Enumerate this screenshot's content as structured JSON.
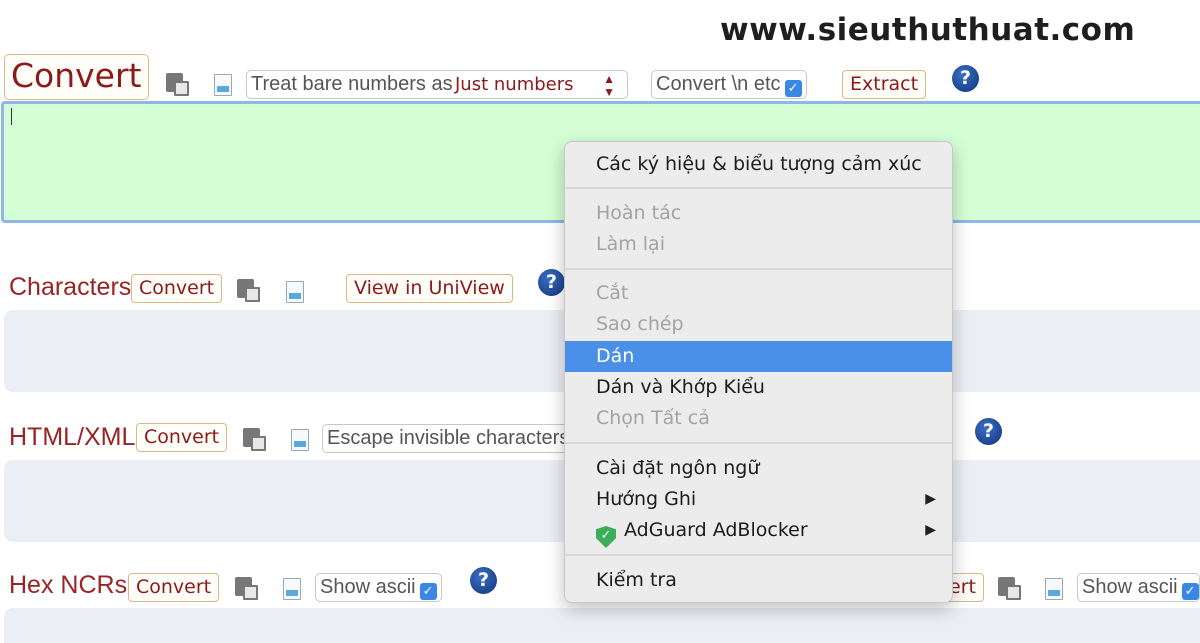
{
  "watermark": "www.sieuthuthuat.com",
  "top": {
    "convert_label": "Convert",
    "treat_label": "Treat bare numbers as",
    "treat_value": "Just numbers",
    "convert_n_label": "Convert \\n etc",
    "extract_label": "Extract",
    "help": "?"
  },
  "characters": {
    "label": "Characters",
    "convert_label": "Convert",
    "view_label": "View in UniView",
    "help": "?"
  },
  "html_xml": {
    "label": "HTML/XML",
    "convert_label": "Convert",
    "escape_label": "Escape invisible characters",
    "help": "?"
  },
  "hex": {
    "label": "Hex NCRs",
    "convert_label": "Convert",
    "show_ascii_label": "Show ascii",
    "help": "?",
    "right_convert_partial": "ert",
    "right_show_ascii": "Show ascii"
  },
  "context_menu": {
    "emoji": "Các ký hiệu & biểu tượng cảm xúc",
    "undo": "Hoàn tác",
    "redo": "Làm lại",
    "cut": "Cắt",
    "copy": "Sao chép",
    "paste": "Dán",
    "paste_match": "Dán và Khớp Kiểu",
    "select_all": "Chọn Tất cả",
    "language": "Cài đặt ngôn ngữ",
    "direction": "Hướng Ghi",
    "adguard": "AdGuard AdBlocker",
    "inspect": "Kiểm tra"
  }
}
